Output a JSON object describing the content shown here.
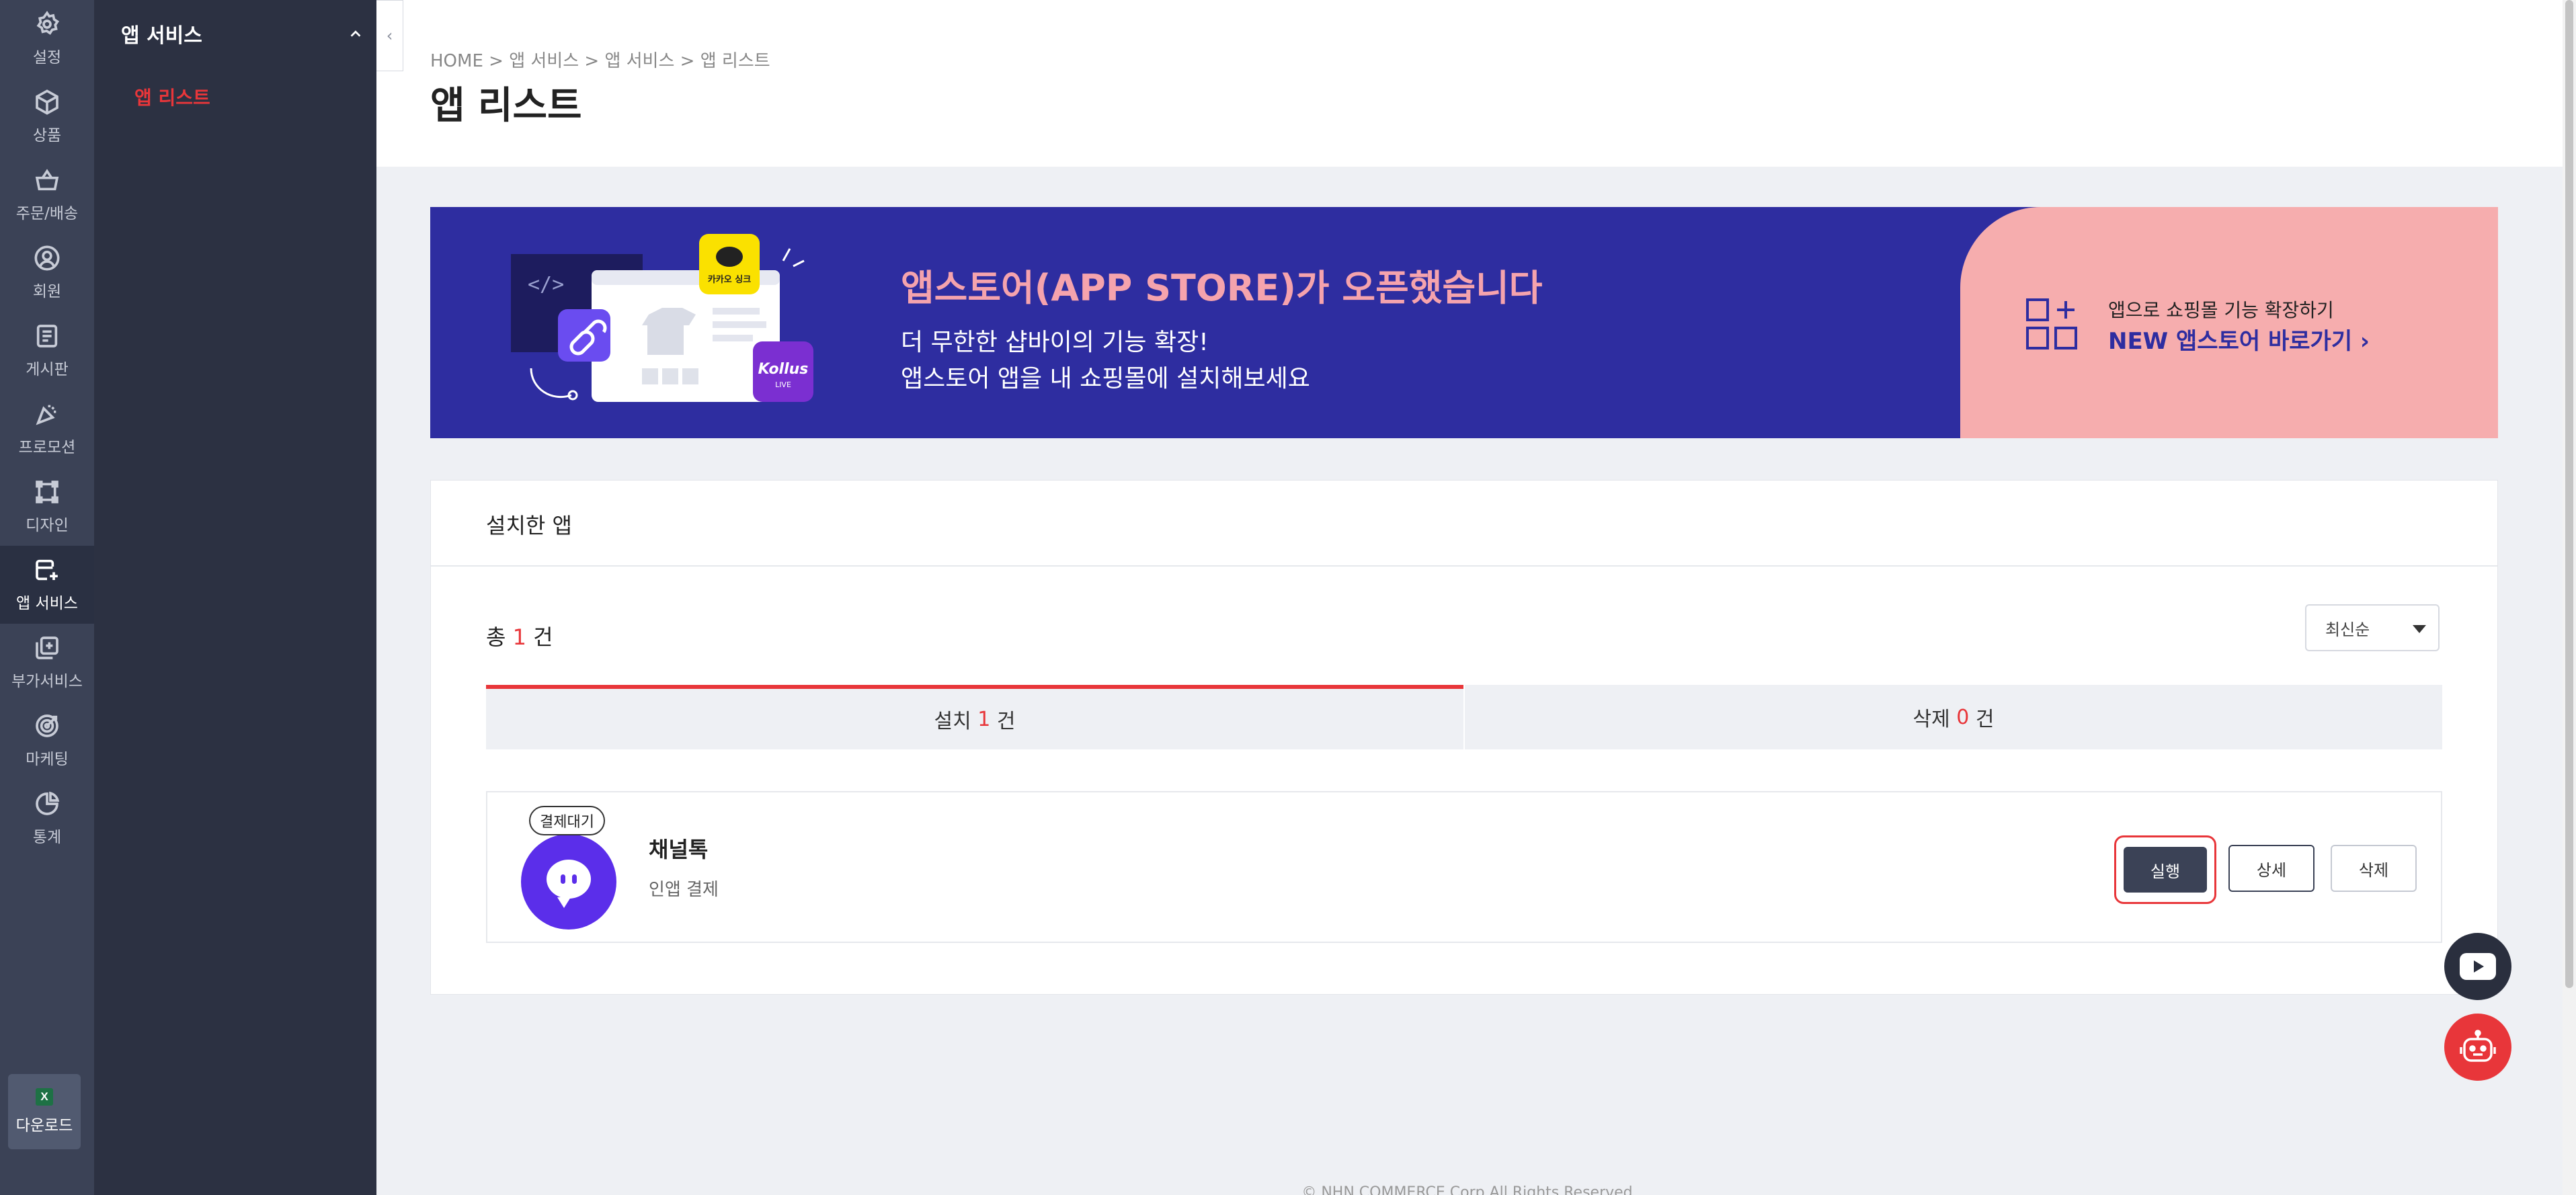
{
  "rail": {
    "items": [
      {
        "label": "설정",
        "icon": "gear-icon"
      },
      {
        "label": "상품",
        "icon": "box-icon"
      },
      {
        "label": "주문/배송",
        "icon": "basket-icon"
      },
      {
        "label": "회원",
        "icon": "user-icon"
      },
      {
        "label": "게시판",
        "icon": "board-icon"
      },
      {
        "label": "프로모션",
        "icon": "party-icon"
      },
      {
        "label": "디자인",
        "icon": "design-icon"
      },
      {
        "label": "앱 서비스",
        "icon": "app-service-icon"
      },
      {
        "label": "부가서비스",
        "icon": "addon-icon"
      },
      {
        "label": "마케팅",
        "icon": "target-icon"
      },
      {
        "label": "통계",
        "icon": "pie-chart-icon"
      }
    ],
    "active_index": 7,
    "download_label": "다운로드",
    "download_icon_text": "X"
  },
  "submenu": {
    "title": "앱 서비스",
    "item": "앱 리스트"
  },
  "header": {
    "breadcrumb": "HOME > 앱 서비스 > 앱 서비스 > 앱 리스트",
    "title": "앱 리스트"
  },
  "banner": {
    "title": "앱스토어(APP STORE)가 오픈했습니다",
    "line1": "더 무한한 샵바이의 기능 확장!",
    "line2": "앱스토어 앱을 내 쇼핑몰에 설치해보세요",
    "cta_sub": "앱으로 쇼핑몰 기능 확장하기",
    "cta": "NEW 앱스토어 바로가기  ›",
    "illustration_badge_kakao": "카카오 싱크",
    "illustration_badge_kollus": "Kollus",
    "illustration_badge_live": "LIVE",
    "colors": {
      "background": "#2e2da0",
      "title": "#f5a3ad",
      "cta_panel": "#f6adae"
    }
  },
  "installed": {
    "section_title": "설치한 앱",
    "total_prefix": "총",
    "total_count": "1",
    "total_suffix": "건",
    "sort": "최신순",
    "tabs": [
      {
        "label": "설치",
        "count": "1",
        "suffix": "건"
      },
      {
        "label": "삭제",
        "count": "0",
        "suffix": "건"
      }
    ],
    "apps": [
      {
        "badge": "결제대기",
        "name": "채널톡",
        "description": "인앱 결제",
        "run_label": "실행",
        "detail_label": "상세",
        "delete_label": "삭제"
      }
    ]
  },
  "floating": {
    "youtube_icon": "youtube-icon",
    "chatbot_icon": "robot-icon"
  },
  "footer": "© NHN COMMERCE Corp All Rights Reserved.",
  "colors": {
    "accent_red": "#e8363a",
    "rail_bg": "#3b4256",
    "submenu_bg": "#2c3142"
  }
}
